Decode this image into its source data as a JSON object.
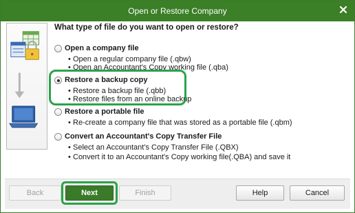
{
  "window": {
    "title": "Open or Restore Company"
  },
  "question": "What type of file do you want to open or restore?",
  "options": [
    {
      "label": "Open a company file",
      "checked": false,
      "bullets": [
        "Open a regular company file (.qbw)",
        "Open an Accountant's Copy working file (.qba)"
      ]
    },
    {
      "label": "Restore a backup copy",
      "checked": true,
      "bullets": [
        "Restore a backup file (.qbb)",
        "Restore files from an online backup"
      ]
    },
    {
      "label": "Restore a portable file",
      "checked": false,
      "bullets": [
        "Re-create a company file that was stored as a portable file (.qbm)"
      ]
    },
    {
      "label": "Convert an Accountant's Copy Transfer File",
      "checked": false,
      "bullets": [
        "Select an Accountant's Copy Transfer File (.QBX)",
        "Convert it to an Accountant's Copy working file(.QBA) and save it"
      ]
    }
  ],
  "buttons": {
    "back": "Back",
    "next": "Next",
    "finish": "Finish",
    "help": "Help",
    "cancel": "Cancel"
  },
  "colors": {
    "titlebar": "#3b7f27",
    "highlight": "#2aa34a",
    "primary": "#3a7b2a"
  },
  "icons": {
    "close": "close-icon",
    "illustration": "company-file-to-laptop-illustration"
  }
}
